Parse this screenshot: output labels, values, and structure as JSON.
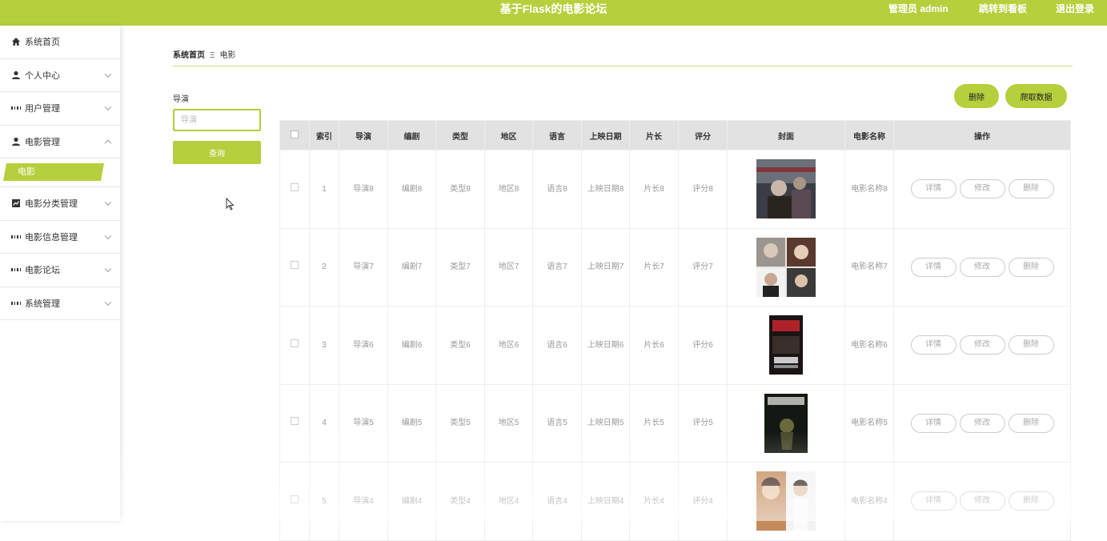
{
  "header": {
    "title": "基于Flask的电影论坛",
    "admin": "管理员 admin",
    "dashboard_link": "跳转到看板",
    "logout": "退出登录"
  },
  "sidebar": {
    "items": [
      {
        "label": "系统首页",
        "icon": "home-icon"
      },
      {
        "label": "个人中心",
        "icon": "user-icon"
      },
      {
        "label": "用户管理",
        "icon": "grid-icon"
      },
      {
        "label": "电影管理",
        "icon": "user-icon"
      },
      {
        "label": "电影分类管理",
        "icon": "chart-icon"
      },
      {
        "label": "电影信息管理",
        "icon": "grid-icon"
      },
      {
        "label": "电影论坛",
        "icon": "grid-icon"
      },
      {
        "label": "系统管理",
        "icon": "grid-icon"
      }
    ],
    "active_sub": "电影"
  },
  "breadcrumb": {
    "home": "系统首页",
    "sep": "Ξ",
    "current": "电影"
  },
  "search": {
    "label": "导演",
    "placeholder": "导演",
    "button": "查询"
  },
  "toolbar": {
    "delete": "删除",
    "crawl": "爬取数据"
  },
  "table": {
    "headers": [
      "索引",
      "导演",
      "编剧",
      "类型",
      "地区",
      "语言",
      "上映日期",
      "片长",
      "评分",
      "封面",
      "电影名称",
      "操作"
    ],
    "actions": {
      "detail": "详情",
      "edit": "修改",
      "delete": "删除"
    },
    "rows": [
      {
        "index": "1",
        "director": "导演8",
        "writer": "编剧8",
        "genre": "类型8",
        "region": "地区8",
        "language": "语言8",
        "release": "上映日期8",
        "length": "片长8",
        "rating": "评分8",
        "name": "电影名称8"
      },
      {
        "index": "2",
        "director": "导演7",
        "writer": "编剧7",
        "genre": "类型7",
        "region": "地区7",
        "language": "语言7",
        "release": "上映日期7",
        "length": "片长7",
        "rating": "评分7",
        "name": "电影名称7"
      },
      {
        "index": "3",
        "director": "导演6",
        "writer": "编剧6",
        "genre": "类型6",
        "region": "地区6",
        "language": "语言6",
        "release": "上映日期6",
        "length": "片长6",
        "rating": "评分6",
        "name": "电影名称6"
      },
      {
        "index": "4",
        "director": "导演5",
        "writer": "编剧5",
        "genre": "类型5",
        "region": "地区5",
        "language": "语言5",
        "release": "上映日期5",
        "length": "片长5",
        "rating": "评分5",
        "name": "电影名称5"
      },
      {
        "index": "5",
        "director": "导演4",
        "writer": "编剧4",
        "genre": "类型4",
        "region": "地区4",
        "language": "语言4",
        "release": "上映日期4",
        "length": "片长4",
        "rating": "评分4",
        "name": "电影名称4"
      }
    ]
  },
  "colors": {
    "accent": "#b6cf3c",
    "header_bg": "#e2e2e2"
  }
}
